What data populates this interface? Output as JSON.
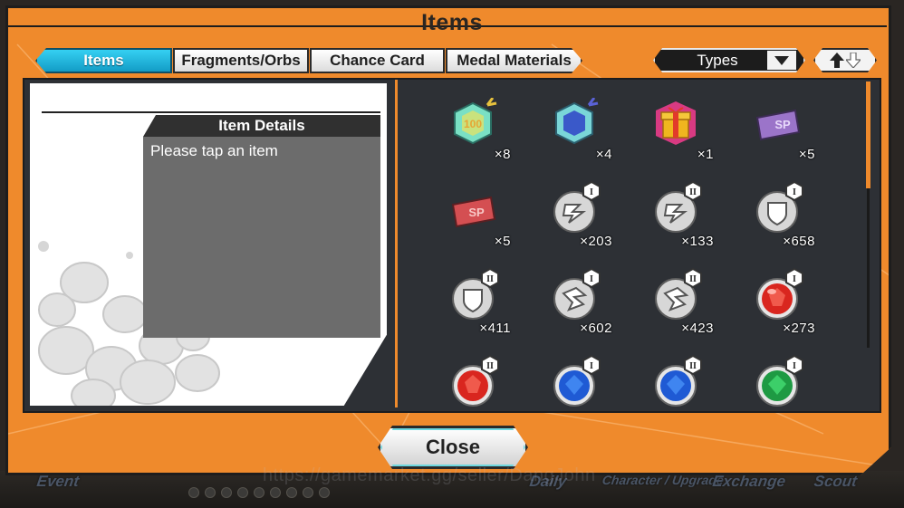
{
  "window": {
    "title": "Items"
  },
  "tabs": [
    {
      "label": "Items",
      "active": true
    },
    {
      "label": "Fragments/Orbs",
      "active": false
    },
    {
      "label": "Chance Card",
      "active": false
    },
    {
      "label": "Medal Materials",
      "active": false
    }
  ],
  "filter": {
    "types_label": "Types",
    "caret_icon": "chevron-down-icon",
    "sort_icon": "sort-toggle-icon"
  },
  "details": {
    "heading": "Item Details",
    "hint": "Please tap an item"
  },
  "items": [
    {
      "icon": "ticket-100-icon",
      "qty": "×8"
    },
    {
      "icon": "ticket-blue-icon",
      "qty": "×4"
    },
    {
      "icon": "gift-box-icon",
      "qty": "×1"
    },
    {
      "icon": "sp-card-purple-icon",
      "qty": "×5"
    },
    {
      "icon": "sp-card-red-icon",
      "qty": "×5"
    },
    {
      "icon": "attack-medal-material-icon",
      "tier": "I",
      "qty": "×203"
    },
    {
      "icon": "attack-medal-material-icon",
      "tier": "II",
      "qty": "×133"
    },
    {
      "icon": "defense-medal-material-icon",
      "tier": "I",
      "qty": "×658"
    },
    {
      "icon": "defense-medal-material-icon",
      "tier": "II",
      "qty": "×411"
    },
    {
      "icon": "speed-medal-material-icon",
      "tier": "I",
      "qty": "×602"
    },
    {
      "icon": "speed-medal-material-icon",
      "tier": "II",
      "qty": "×423"
    },
    {
      "icon": "red-orb-icon",
      "tier": "I",
      "qty": "×273"
    },
    {
      "icon": "red-orb-icon",
      "tier": "II",
      "qty": ""
    },
    {
      "icon": "blue-orb-icon",
      "tier": "I",
      "qty": ""
    },
    {
      "icon": "blue-orb-icon",
      "tier": "II",
      "qty": ""
    },
    {
      "icon": "green-orb-icon",
      "tier": "I",
      "qty": ""
    }
  ],
  "close_label": "Close",
  "bottom_nav": [
    "Event",
    "Daily",
    "Character / Upgrade",
    "Exchange",
    "Scout"
  ],
  "watermark": "https://gamemarket.gg/seller/DangJohn",
  "colors": {
    "frame": "#ef8a2c",
    "active_tab": "#1fb2da",
    "panel": "#2d3035"
  }
}
